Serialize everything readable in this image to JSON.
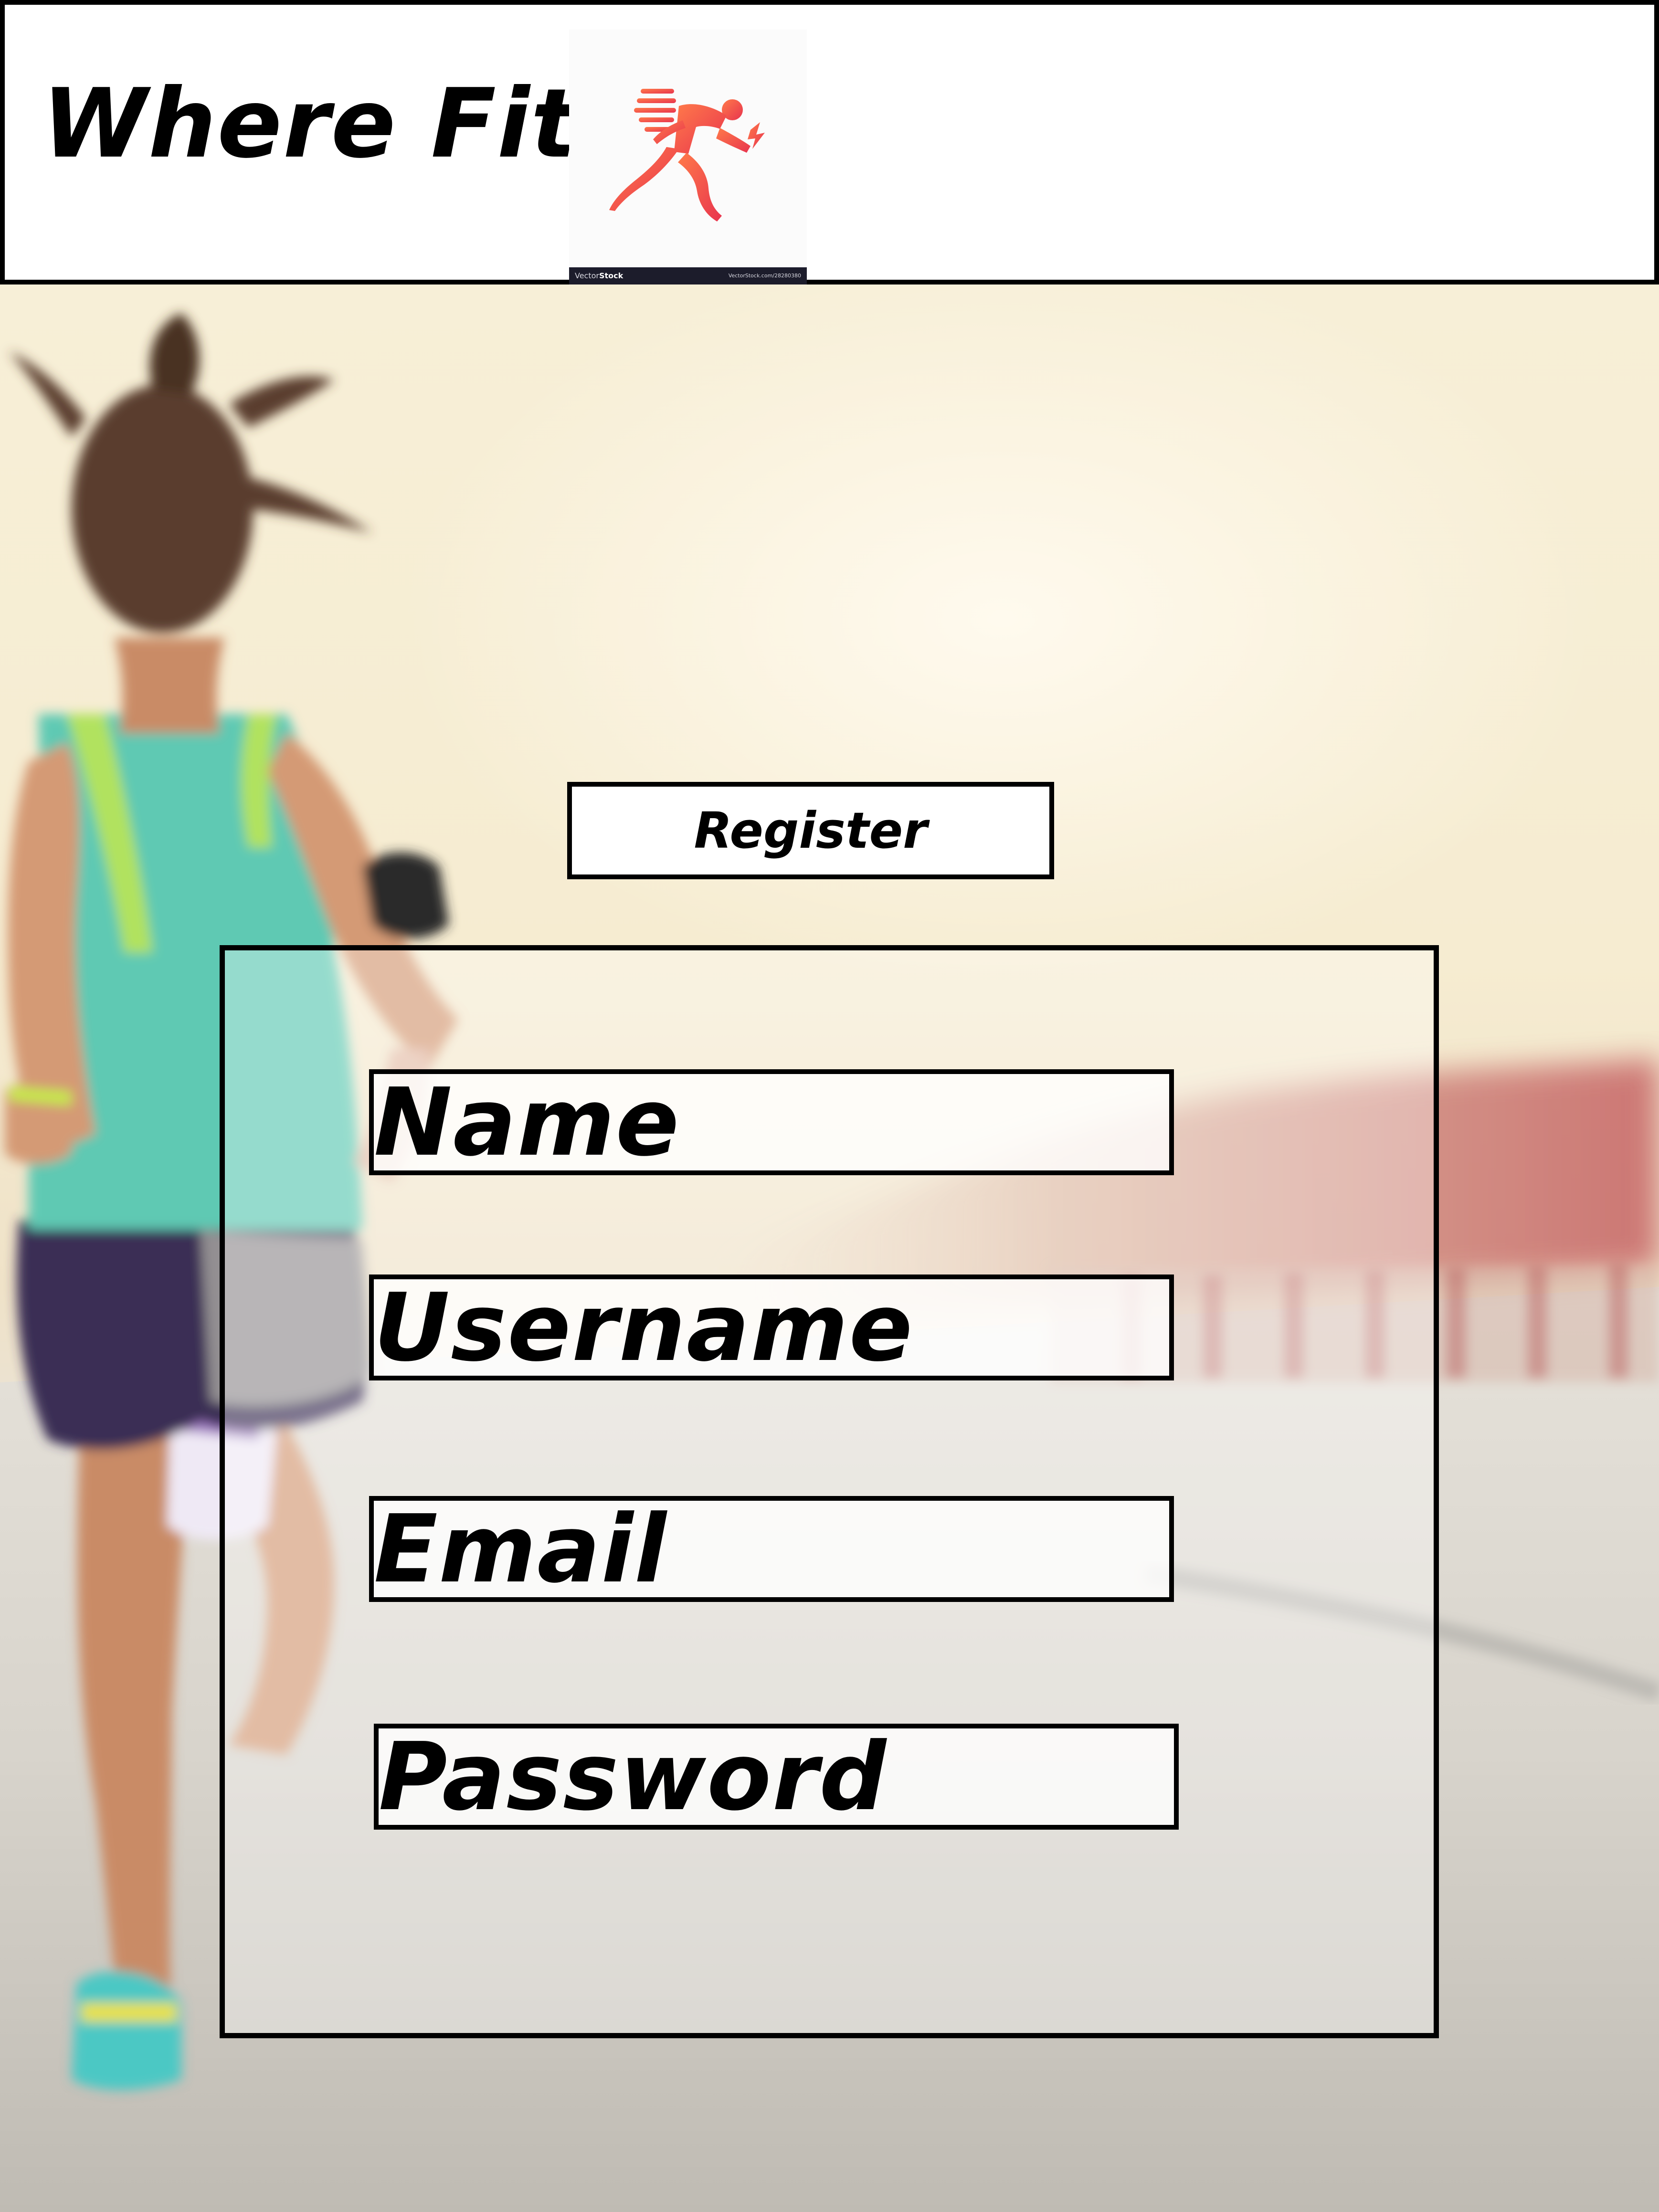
{
  "header": {
    "title": "Where Fit",
    "logo": {
      "icon": "sprinter-icon",
      "brand_prefix": "Vector",
      "brand_suffix": "Stock",
      "reference": "VectorStock.com/28280380",
      "accent": "#ef4f4f"
    }
  },
  "actions": {
    "register_label": "Register"
  },
  "form": {
    "fields": [
      {
        "label": "Name"
      },
      {
        "label": "Username"
      },
      {
        "label": "Email"
      },
      {
        "label": "Password"
      }
    ]
  },
  "colors": {
    "border": "#000000",
    "header_bg": "#ffffff",
    "logo_gradient_start": "#ff7a4a",
    "logo_gradient_end": "#e8344e"
  }
}
